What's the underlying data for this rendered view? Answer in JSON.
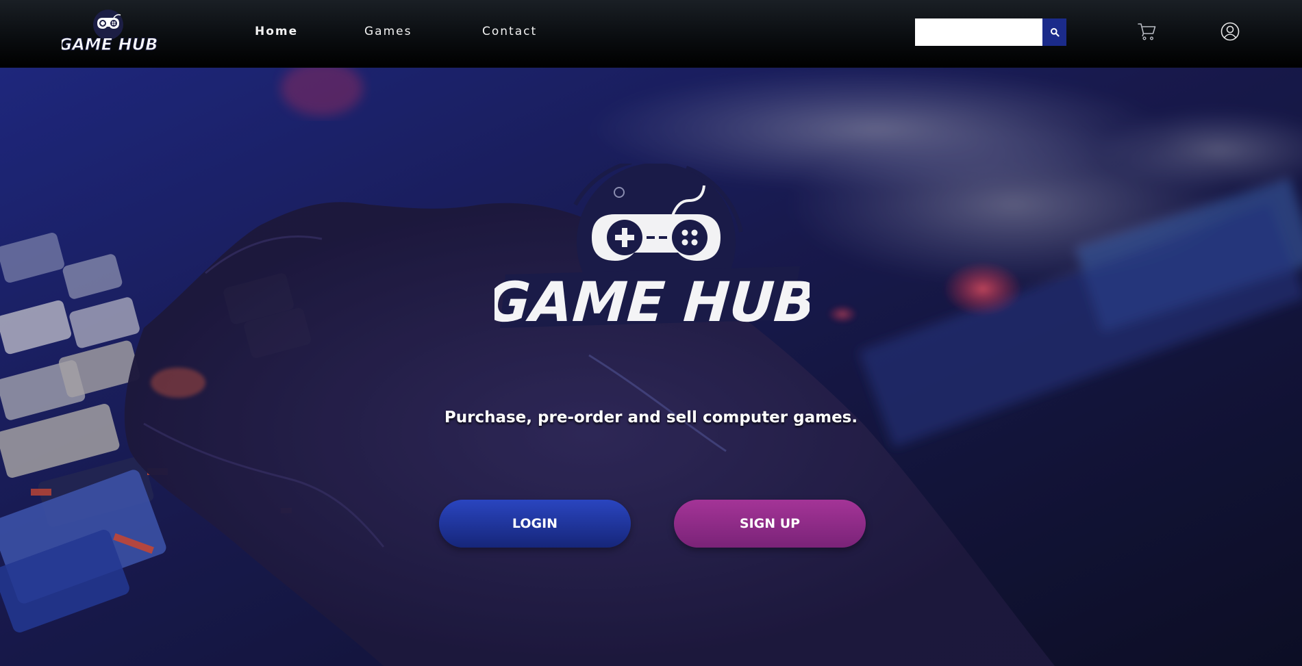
{
  "brand": {
    "logo_text": "GAME HUB"
  },
  "nav": {
    "links": [
      {
        "label": "Home",
        "active": true
      },
      {
        "label": "Games",
        "active": false
      },
      {
        "label": "Contact",
        "active": false
      }
    ]
  },
  "search": {
    "placeholder": "",
    "value": "",
    "button_icon": "search-icon"
  },
  "header_icons": {
    "cart": "cart-icon",
    "account": "user-circle-icon"
  },
  "hero": {
    "tagline": "Purchase, pre-order and sell computer games.",
    "login_label": "LOGIN",
    "signup_label": "SIGN UP"
  },
  "colors": {
    "navbar": "#0a0d10",
    "search_button": "#1b2b8a",
    "login_button": "#1f35a0",
    "signup_button": "#902c88",
    "logo_circle": "#1a1c45"
  }
}
